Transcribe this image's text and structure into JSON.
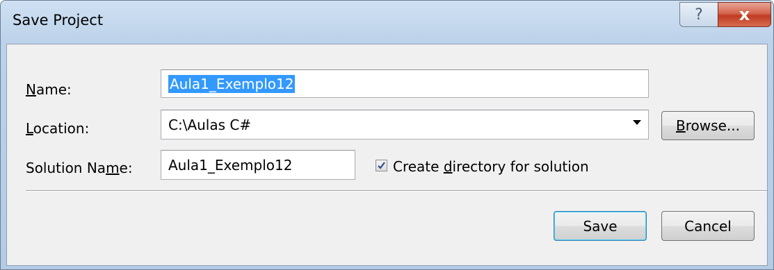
{
  "window": {
    "title": "Save Project",
    "help_glyph": "?",
    "close_glyph": "x"
  },
  "form": {
    "name": {
      "label_pre": "",
      "label_accel": "N",
      "label_post": "ame:",
      "value": "Aula1_Exemplo12"
    },
    "location": {
      "label_pre": "",
      "label_accel": "L",
      "label_post": "ocation:",
      "value": "C:\\Aulas C#"
    },
    "solution_name": {
      "label_pre": "Solution Na",
      "label_accel": "m",
      "label_post": "e:",
      "value": "Aula1_Exemplo12"
    },
    "create_directory": {
      "checked": true,
      "label_pre": "Create ",
      "label_accel": "d",
      "label_post": "irectory for solution"
    }
  },
  "buttons": {
    "browse": {
      "label_pre": "",
      "label_accel": "B",
      "label_post": "rowse..."
    },
    "save": "Save",
    "cancel": "Cancel"
  },
  "colors": {
    "selection": "#3399ff",
    "default_button_border": "#3c7fb1",
    "close_button": "#c23b23"
  },
  "icons": {
    "checkbox_mark": "check-icon",
    "combo_arrow": "dropdown-arrow-icon"
  }
}
